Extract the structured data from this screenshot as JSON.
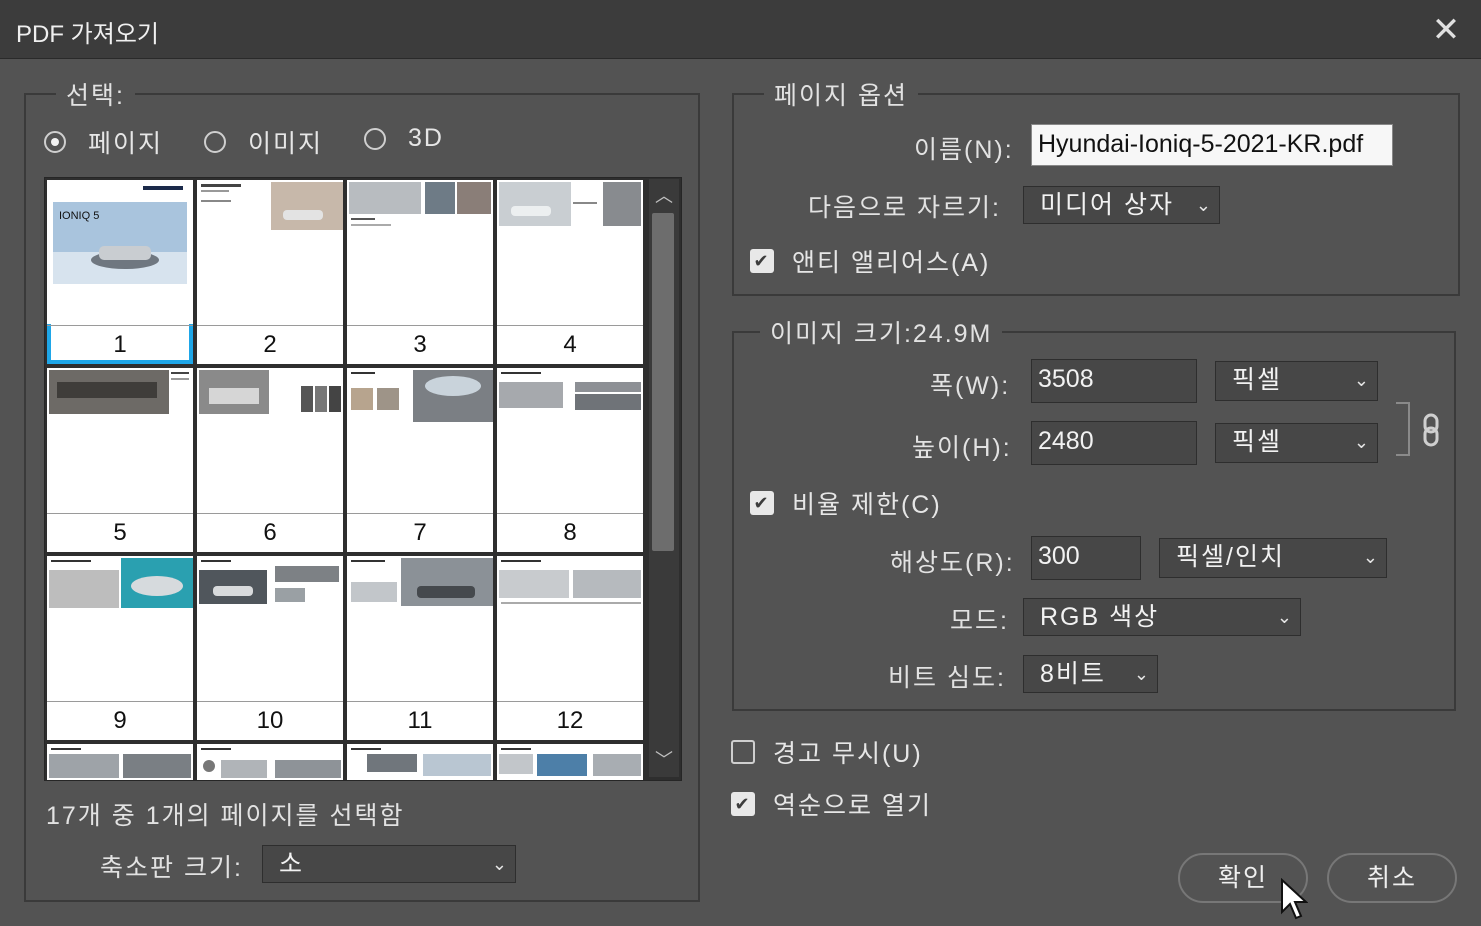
{
  "window": {
    "title": "PDF 가져오기",
    "close_label": "✕"
  },
  "select_group": {
    "legend": "선택:",
    "options": [
      {
        "label": "페이지",
        "selected": true
      },
      {
        "label": "이미지",
        "selected": false
      },
      {
        "label": "3D",
        "selected": false
      }
    ],
    "pages": [
      "1",
      "2",
      "3",
      "4",
      "5",
      "6",
      "7",
      "8",
      "9",
      "10",
      "11",
      "12"
    ],
    "selected_page": "1",
    "thumbnail_cover_text": "IONIQ 5",
    "status": "17개 중 1개의 페이지를 선택함",
    "thumb_size_label": "축소판 크기:",
    "thumb_size_value": "소"
  },
  "page_options": {
    "legend": "페이지 옵션",
    "name_label": "이름(N):",
    "name_value": "Hyundai-Ioniq-5-2021-KR.pdf",
    "crop_label": "다음으로 자르기:",
    "crop_value": "미디어 상자",
    "antialias_label": "앤티 앨리어스(A)",
    "antialias_checked": true
  },
  "image_size": {
    "legend": "이미지 크기:24.9M",
    "width_label": "폭(W):",
    "width_value": "3508",
    "width_unit": "픽셀",
    "height_label": "높이(H):",
    "height_value": "2480",
    "height_unit": "픽셀",
    "constrain_label": "비율 제한(C)",
    "constrain_checked": true,
    "resolution_label": "해상도(R):",
    "resolution_value": "300",
    "resolution_unit": "픽셀/인치",
    "mode_label": "모드:",
    "mode_value": "RGB 색상",
    "bitdepth_label": "비트 심도:",
    "bitdepth_value": "8비트"
  },
  "options": {
    "suppress_warnings_label": "경고 무시(U)",
    "suppress_warnings_checked": false,
    "reverse_order_label": "역순으로 열기",
    "reverse_order_checked": true
  },
  "buttons": {
    "ok": "확인",
    "cancel": "취소"
  },
  "colors": {
    "background": "#535353",
    "titlebar": "#3c3c3c",
    "selection": "#1ea6e8"
  }
}
